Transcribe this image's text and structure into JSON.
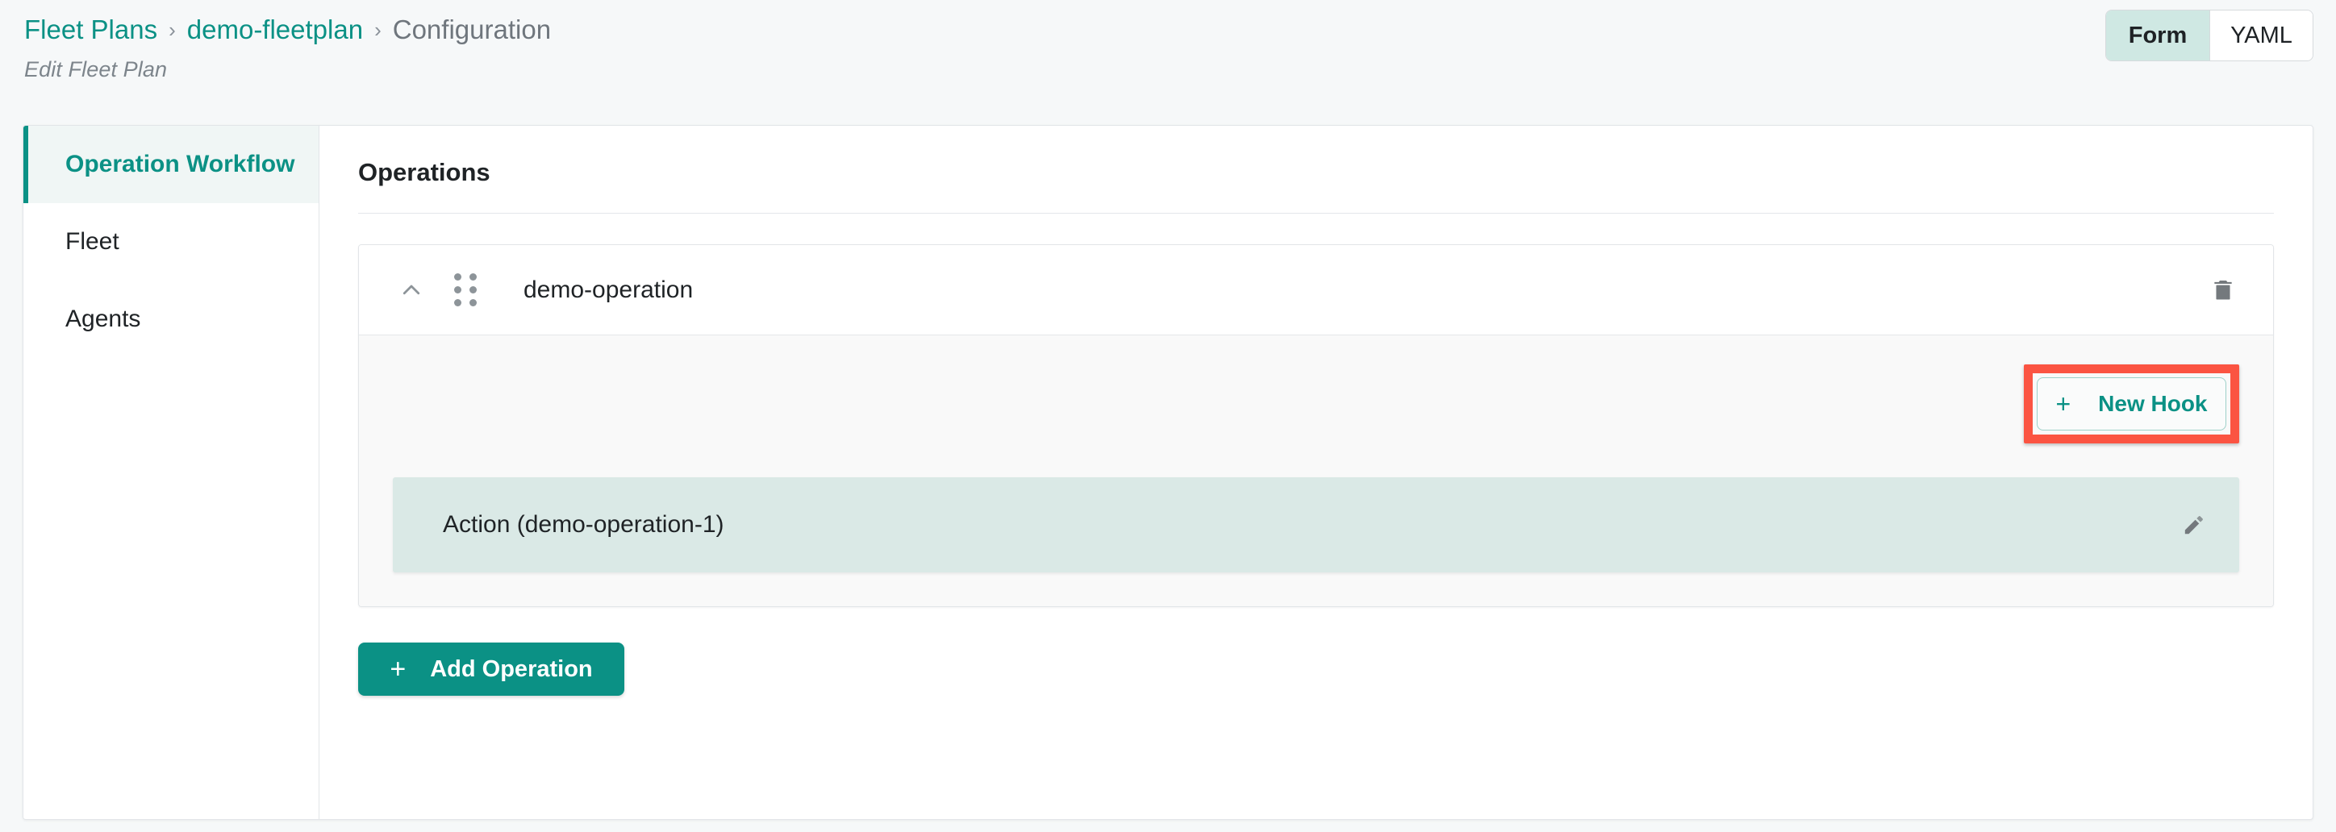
{
  "header": {
    "breadcrumb": [
      {
        "label": "Fleet Plans",
        "type": "link"
      },
      {
        "label": "demo-fleetplan",
        "type": "link"
      },
      {
        "label": "Configuration",
        "type": "current"
      }
    ],
    "separator": "›",
    "subtitle": "Edit Fleet Plan",
    "view_toggle": {
      "options": [
        {
          "label": "Form",
          "active": true
        },
        {
          "label": "YAML",
          "active": false
        }
      ]
    }
  },
  "sidebar": {
    "items": [
      {
        "label": "Operation Workflow",
        "active": true
      },
      {
        "label": "Fleet",
        "active": false
      },
      {
        "label": "Agents",
        "active": false
      }
    ]
  },
  "main": {
    "section_title": "Operations",
    "operations": [
      {
        "name": "demo-operation",
        "collapse_icon": "chevron-up-icon",
        "drag_icon": "drag-handle-icon",
        "delete_icon": "trash-icon",
        "new_hook_label": "New Hook",
        "new_hook_plus": "+",
        "hooks": [
          {
            "label": "Action (demo-operation-1)",
            "edit_icon": "pencil-icon"
          }
        ]
      }
    ],
    "add_operation_label": "Add Operation",
    "add_operation_plus": "+"
  },
  "colors": {
    "accent_teal": "#0b9185",
    "highlight_red": "#fb5442",
    "hook_row_bg": "#dae9e6",
    "active_tab_bg": "#cfe8e3",
    "page_bg": "#f6f8f9"
  }
}
